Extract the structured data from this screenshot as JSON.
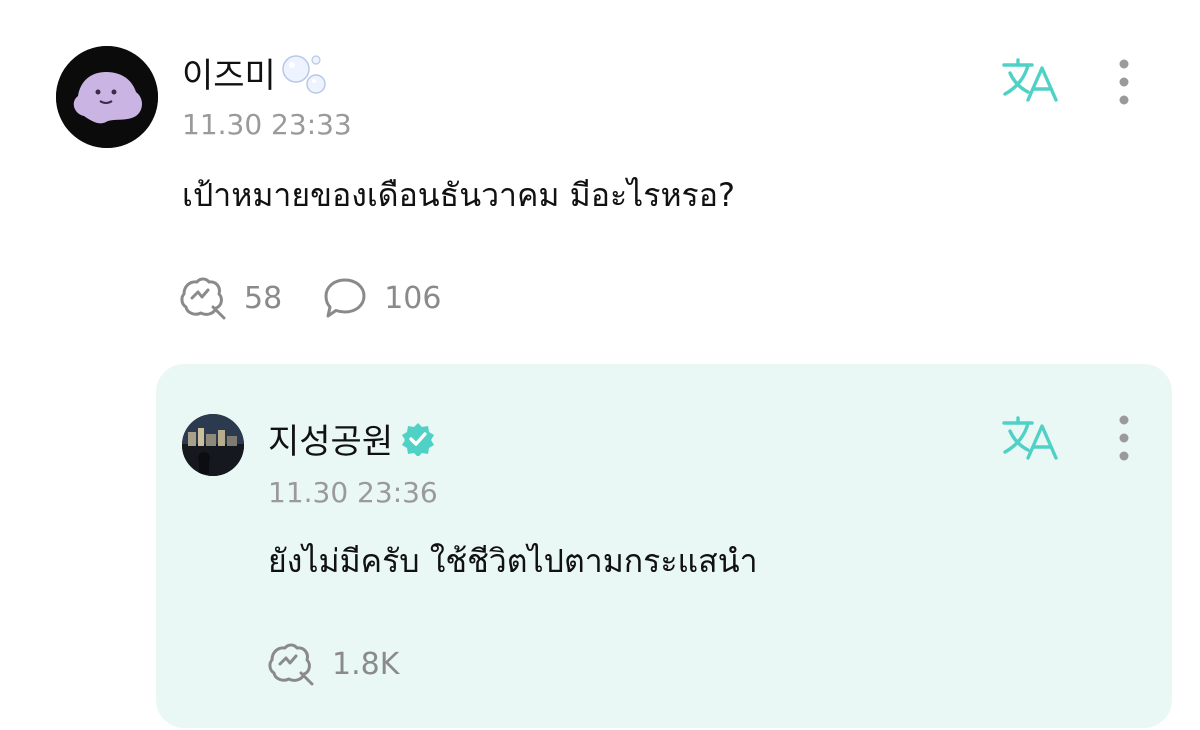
{
  "post": {
    "author": "이즈미",
    "time": "11.30 23:33",
    "text": "เป้าหมายของเดือนธันวาคม มีอะไรหรอ?",
    "reactions": "58",
    "comments": "106"
  },
  "reply": {
    "author": "지성공원",
    "time": "11.30 23:36",
    "text": "ยังไม่มีครับ ใช้ชีวิตไปตามกระแสนำ",
    "reactions": "1.8K"
  },
  "icons": {
    "translate": "translate-icon",
    "more": "more-vertical-icon",
    "reaction": "reaction-icon",
    "comment": "comment-icon",
    "verified": "verified-badge-icon",
    "bubbles": "bubbles-icon"
  },
  "colors": {
    "accent": "#4fd1c5",
    "reply_bg": "#eaf8f5",
    "muted": "#9a9a9a",
    "text": "#111111"
  }
}
